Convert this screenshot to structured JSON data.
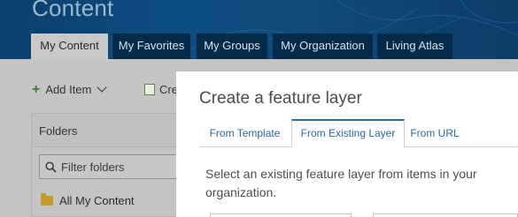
{
  "header": {
    "title": "Content"
  },
  "tabs": [
    {
      "label": "My Content",
      "active": true
    },
    {
      "label": "My Favorites",
      "active": false
    },
    {
      "label": "My Groups",
      "active": false
    },
    {
      "label": "My Organization",
      "active": false
    },
    {
      "label": "Living Atlas",
      "active": false
    }
  ],
  "toolbar": {
    "add_item_label": "Add Item",
    "create_label": "Cre"
  },
  "folders": {
    "heading": "Folders",
    "filter_placeholder": "Filter folders",
    "all_content_label": "All My Content"
  },
  "modal": {
    "title": "Create a feature layer",
    "tabs": [
      {
        "label": "From Template",
        "selected": false
      },
      {
        "label": "From Existing Layer",
        "selected": true
      },
      {
        "label": "From URL",
        "selected": false
      }
    ],
    "description": "Select an existing feature layer from items in your organization."
  },
  "colors": {
    "header_bg": "#0d4d82",
    "tab_inactive_bg": "#052a4a",
    "link_blue": "#2b6aa3",
    "add_icon_green": "#3a7d2c",
    "folder_icon": "#c79a2a"
  }
}
